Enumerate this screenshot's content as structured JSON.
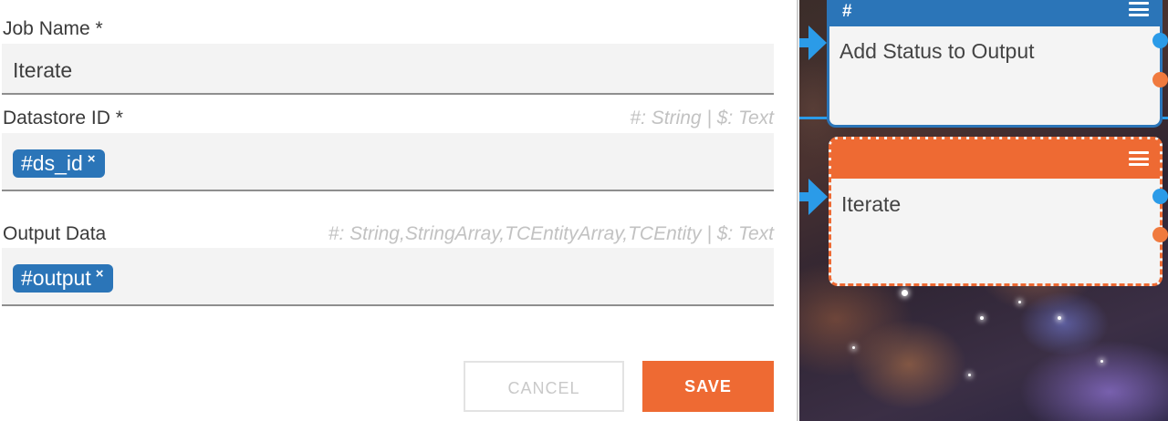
{
  "form": {
    "job_name": {
      "label": "Job Name *",
      "value": "Iterate"
    },
    "datastore_id": {
      "label": "Datastore ID *",
      "hint": "#: String  |  $: Text",
      "chip": "#ds_id",
      "chip_remove": "×"
    },
    "output_data": {
      "label": "Output Data",
      "hint": "#: String,StringArray,TCEntityArray,TCEntity  |  $: Text",
      "chip": "#output",
      "chip_remove": "×"
    },
    "cancel_label": "CANCEL",
    "save_label": "SAVE"
  },
  "canvas": {
    "nodes": [
      {
        "title": "Add Status to Output",
        "header_symbol": "#",
        "color": "#2b75b8",
        "state": "normal"
      },
      {
        "title": "Iterate",
        "header_symbol": "",
        "color": "#ee6a33",
        "state": "selected"
      }
    ],
    "icons": [
      "menu-icon",
      "arrow-right-icon",
      "output-port",
      "input-port"
    ]
  },
  "colors": {
    "primary_blue": "#2b75b8",
    "accent_orange": "#ee6a33",
    "connector_blue": "#2b9be8"
  }
}
